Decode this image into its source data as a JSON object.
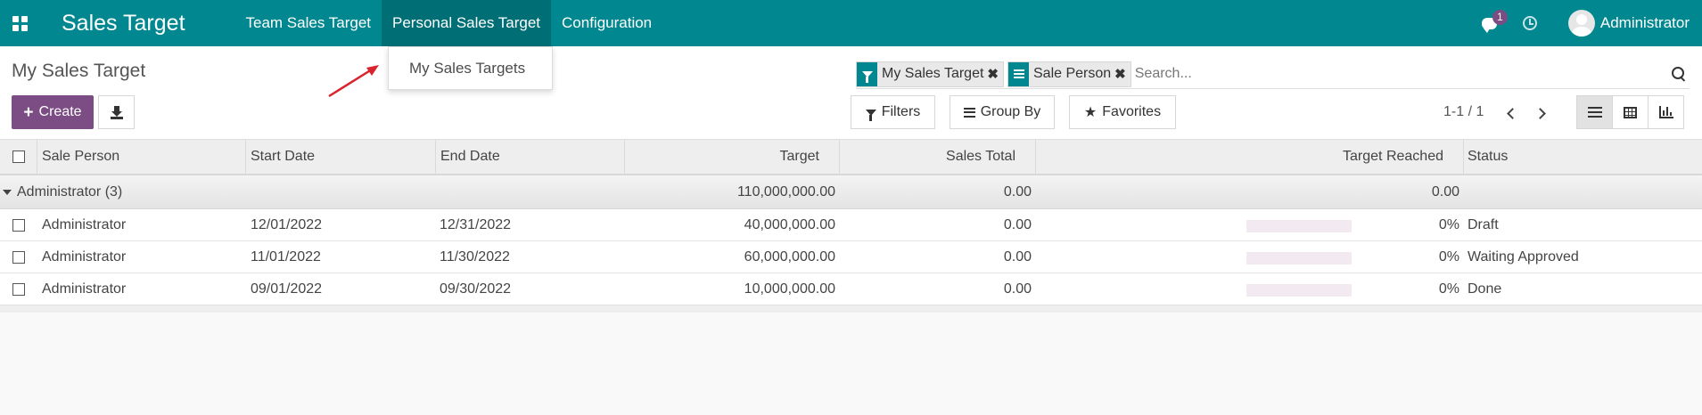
{
  "navbar": {
    "app_title": "Sales Target",
    "menu": [
      "Team Sales Target",
      "Personal Sales Target",
      "Configuration"
    ],
    "active_menu": "Personal Sales Target",
    "chat_badge": "1",
    "user_name": "Administrator",
    "icons": [
      "apps-grid-icon",
      "chat-icon",
      "clock-icon",
      "avatar"
    ]
  },
  "dropdown": {
    "items": [
      "My Sales Targets"
    ]
  },
  "control_panel": {
    "title": "My Sales Target",
    "create_label": "Create",
    "search": {
      "facets": [
        {
          "icon": "filter-icon",
          "label": "My Sales Target"
        },
        {
          "icon": "group-by-icon",
          "label": "Sale Person"
        }
      ],
      "placeholder": "Search..."
    },
    "filters_label": "Filters",
    "group_by_label": "Group By",
    "favorites_label": "Favorites",
    "pager": "1-1 / 1",
    "views": [
      "list-view-icon",
      "pivot-view-icon",
      "graph-view-icon"
    ],
    "active_view": "list"
  },
  "table": {
    "columns": [
      "Sale Person",
      "Start Date",
      "End Date",
      "Target",
      "Sales Total",
      "Target Reached",
      "Status"
    ],
    "group": {
      "label": "Administrator (3)",
      "target": "110,000,000.00",
      "sales_total": "0.00",
      "target_reached": "0.00"
    },
    "rows": [
      {
        "sale_person": "Administrator",
        "start_date": "12/01/2022",
        "end_date": "12/31/2022",
        "target": "40,000,000.00",
        "sales_total": "0.00",
        "reached_pct": "0%",
        "reached_fraction": 0,
        "status": "Draft"
      },
      {
        "sale_person": "Administrator",
        "start_date": "11/01/2022",
        "end_date": "11/30/2022",
        "target": "60,000,000.00",
        "sales_total": "0.00",
        "reached_pct": "0%",
        "reached_fraction": 0,
        "status": "Waiting Approved"
      },
      {
        "sale_person": "Administrator",
        "start_date": "09/01/2022",
        "end_date": "09/30/2022",
        "target": "10,000,000.00",
        "sales_total": "0.00",
        "reached_pct": "0%",
        "reached_fraction": 0,
        "status": "Done"
      }
    ]
  },
  "colors": {
    "navbar": "#00878f",
    "active_menu": "#006e75",
    "primary_button": "#7c4c84",
    "annotation_arrow": "#d9232d"
  }
}
